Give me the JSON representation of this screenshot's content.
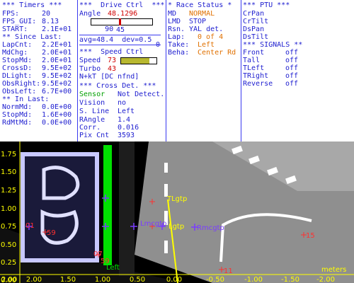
{
  "timers": {
    "header": "*** Timers ***",
    "fps_label": "FPS:",
    "fps_value": "20",
    "fps_gui_label": "FPS_GUI:",
    "fps_gui_value": "8.13",
    "start_label": "START:",
    "start_value": "2.1E+01",
    "since_last_header": "** Since Last:",
    "since_last": [
      {
        "label": "LapCnt:",
        "value": "2.2E+01"
      },
      {
        "label": "MdChg:",
        "value": "2.0E+01"
      },
      {
        "label": "StopMd:",
        "value": "2.0E+01"
      },
      {
        "label": "CrossD:",
        "value": "9.5E+02"
      },
      {
        "label": "DLight:",
        "value": "9.5E+02"
      },
      {
        "label": "ObsRight:",
        "value": "9.5E+02"
      },
      {
        "label": "ObsLeft:",
        "value": "6.7E+00"
      }
    ],
    "in_last_header": "** In Last:",
    "in_last": [
      {
        "label": "NormMd:",
        "value": "0.0E+00"
      },
      {
        "label": "StopMd:",
        "value": "1.6E+00"
      },
      {
        "label": "RdMtMd:",
        "value": "0.0E+00"
      }
    ]
  },
  "drive": {
    "header": "***  Drive Ctrl  ***",
    "angle_label": "Angle",
    "angle_value": "48.1296",
    "slider_min": "90",
    "slider_max": "0",
    "slider_fraction": 0.47,
    "slider_center": "45",
    "avg_text": "avg=48.4  dev=0.5",
    "speed_header": "***  Speed Ctrl",
    "speed_label": "Speed",
    "speed_value": "73",
    "speed_fraction": 0.8,
    "turbo_label": "Turbo",
    "turbo_value": "43",
    "next_text": "N+kT [DC nfnd]",
    "cross_header": "*** Cross Det. ***",
    "cross_rows": [
      {
        "label": "Sensor",
        "value": "Not Detect."
      },
      {
        "label": "Vision",
        "value": "no"
      },
      {
        "label": "S. Line",
        "value": "Left"
      },
      {
        "label": "RAngle",
        "value": "1.4"
      },
      {
        "label": "Corr.",
        "value": "0.016"
      },
      {
        "label": "Pix Cnt",
        "value": "3593"
      }
    ]
  },
  "race": {
    "header": "* Race Status *",
    "rows": [
      {
        "label": "MD",
        "value": "NORMAL"
      },
      {
        "label": "LMD",
        "value": "STOP"
      },
      {
        "label": "Rsn.",
        "value": "YAL det."
      },
      {
        "label": "Lap:",
        "value": "0 of 4"
      },
      {
        "label": "Take:",
        "value": "Left"
      },
      {
        "label": "Beha:",
        "value": "Center Rd"
      }
    ]
  },
  "ptu": {
    "header": "*** PTU ***",
    "items": [
      "CrPan",
      "CrTilt",
      "DsPan",
      "DsTilt"
    ],
    "signals_header": "*** SIGNALS **",
    "signals": [
      {
        "label": "Front",
        "value": "off"
      },
      {
        "label": "Tall",
        "value": "off"
      },
      {
        "label": "TLeft",
        "value": "off"
      },
      {
        "label": "TRight",
        "value": "off"
      },
      {
        "label": "Reverse",
        "value": "off"
      }
    ]
  },
  "view": {
    "y_ticks": [
      "1.75",
      "1.50",
      "1.25",
      "1.00",
      "0.75",
      "0.50",
      "0.25",
      "0.00"
    ],
    "x_ticks": [
      "2.00",
      "1.50",
      "1.00",
      "0.50",
      "0.00",
      "-0.50",
      "-1.00",
      "-1.50",
      "-2.00"
    ],
    "x_extra_tick": "2.00",
    "units_label": "meters",
    "markers": [
      "01",
      "59",
      "07",
      "59",
      "15",
      "11"
    ],
    "labels": {
      "left": "Left",
      "tlgtp": "TLgtp",
      "lmcgtp": "Lmcgtp",
      "lgtp": "Lgtp",
      "rmcgtp": "Rmcgtp"
    },
    "colors": {
      "axis": "#ffff00",
      "marker": "#ff3030",
      "cross": "#7a3cff",
      "green_line": "#00e000",
      "road": "#9a9a9a"
    }
  }
}
